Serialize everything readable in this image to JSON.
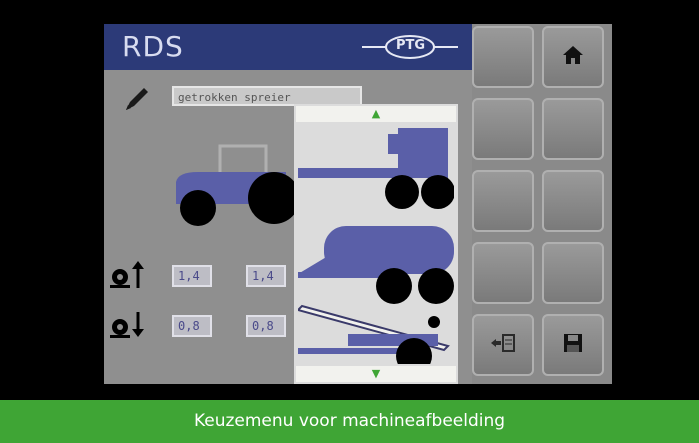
{
  "header": {
    "title": "RDS",
    "brand_logo": "PTG"
  },
  "machine": {
    "name_value": "getrokken spreier"
  },
  "pressure": {
    "up_icon": "tire-pressure-up-icon",
    "down_icon": "tire-pressure-down-icon",
    "front_up": "1,4",
    "rear_up": "1,4",
    "front_down": "0,8",
    "rear_down": "0,8"
  },
  "picker": {
    "options": [
      "trailer-sprayer",
      "tank-trailer",
      "liquid-spreader"
    ],
    "accent": "#3fa535"
  },
  "softkeys": {
    "home_icon": "home-icon",
    "import_icon": "import-icon",
    "save_icon": "save-icon"
  },
  "caption": "Keuzemenu voor machineafbeelding",
  "colors": {
    "title_bar": "#2c3a78",
    "machine_blue": "#5a5fa8",
    "caption_bg": "#3fa535"
  }
}
